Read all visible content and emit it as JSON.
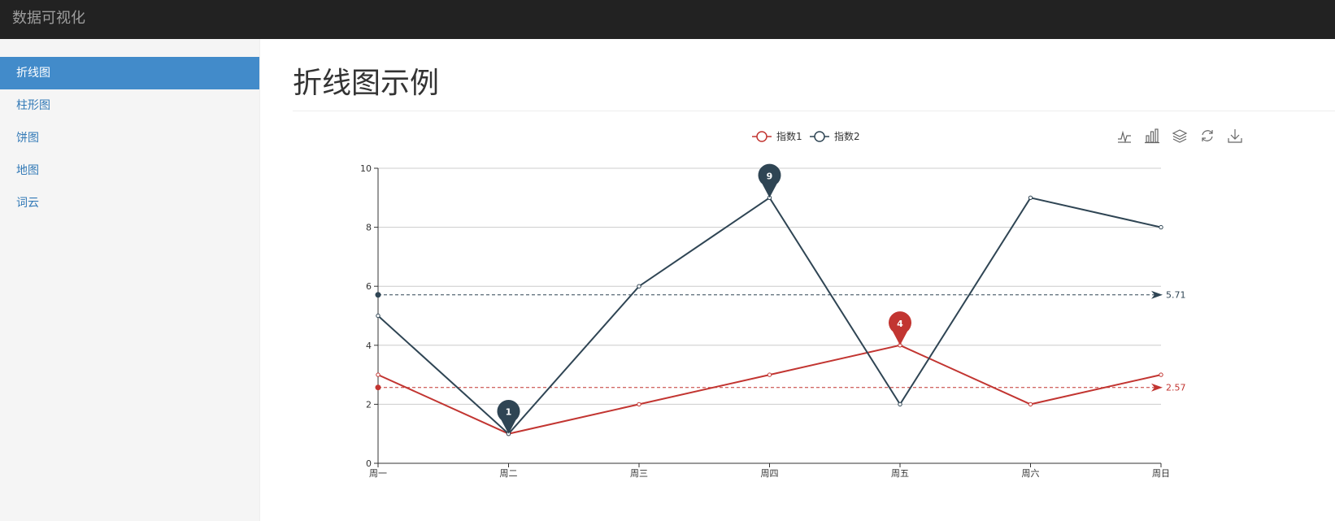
{
  "app": {
    "brand": "数据可视化"
  },
  "sidebar": {
    "items": [
      {
        "label": "折线图",
        "active": true
      },
      {
        "label": "柱形图",
        "active": false
      },
      {
        "label": "饼图",
        "active": false
      },
      {
        "label": "地图",
        "active": false
      },
      {
        "label": "词云",
        "active": false
      }
    ]
  },
  "main": {
    "title": "折线图示例"
  },
  "toolbox": {
    "icons": [
      "line-chart-icon",
      "bar-chart-icon",
      "stack-icon",
      "restore-icon",
      "download-icon"
    ]
  },
  "chart_data": {
    "type": "line",
    "categories": [
      "周一",
      "周二",
      "周三",
      "周四",
      "周五",
      "周六",
      "周日"
    ],
    "ylim": [
      0,
      10
    ],
    "yticks": [
      0,
      2,
      4,
      6,
      8,
      10
    ],
    "grid": true,
    "legend": "top-center",
    "series": [
      {
        "name": "指数1",
        "color": "#c23531",
        "values": [
          3,
          1,
          2,
          3,
          4,
          2,
          3
        ],
        "max_marker": {
          "category": "周五",
          "value": 4,
          "label": "4"
        },
        "mean_line": {
          "value": 2.57,
          "label": "2.57"
        }
      },
      {
        "name": "指数2",
        "color": "#2f4554",
        "values": [
          5,
          1,
          6,
          9,
          2,
          9,
          8
        ],
        "max_marker": {
          "category": "周四",
          "value": 9,
          "label": "9"
        },
        "min_marker": {
          "category": "周二",
          "value": 1,
          "label": "1"
        },
        "mean_line": {
          "value": 5.71,
          "label": "5.71"
        }
      }
    ]
  }
}
